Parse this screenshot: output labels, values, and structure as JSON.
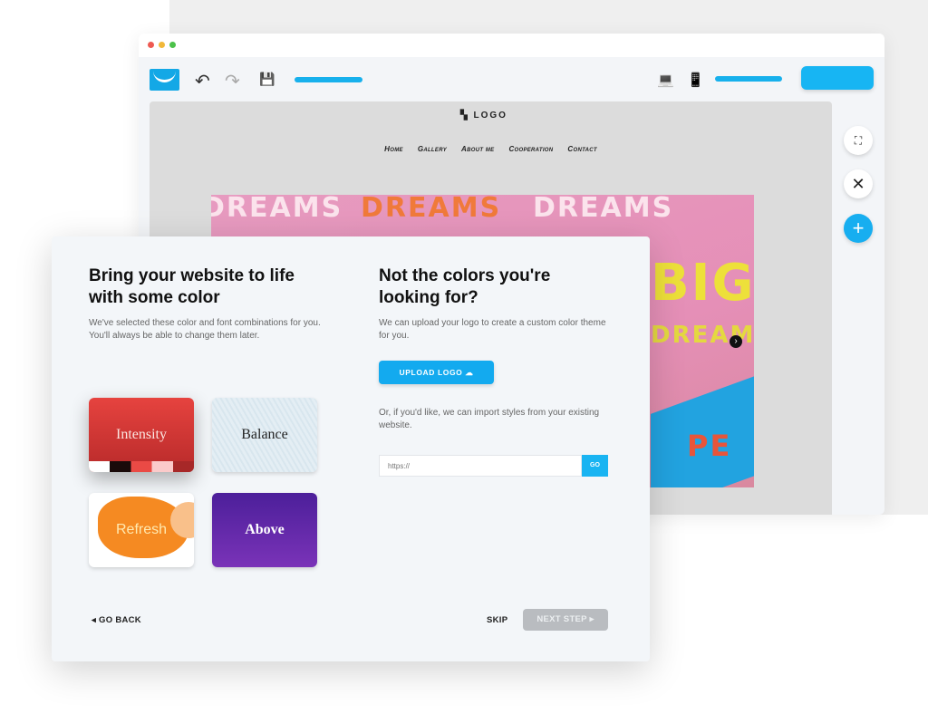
{
  "editor": {
    "site_logo": "LOGO",
    "nav": [
      "Home",
      "Gallery",
      "About me",
      "Cooperation",
      "Contact"
    ],
    "hero_texts": [
      "DREAMS",
      "DREAMS",
      "DREAMS",
      "BIG",
      "DREAMS",
      "PE"
    ],
    "icons": {
      "undo": "↶",
      "redo": "↷",
      "save": "💾",
      "laptop": "💻",
      "phone": "📱",
      "sitemap": "⛶",
      "close": "✕",
      "add": "+",
      "next": "›"
    }
  },
  "modal": {
    "left": {
      "title": "Bring your website to life with some color",
      "description": "We've selected these color and font combinations for you. You'll always be able to change them later."
    },
    "themes": [
      {
        "label": "Intensity"
      },
      {
        "label": "Balance"
      },
      {
        "label": "Refresh"
      },
      {
        "label": "Above"
      }
    ],
    "right": {
      "title": "Not the colors you're looking for?",
      "description": "We can upload your logo to create a custom color theme for you.",
      "upload_label": "UPLOAD LOGO",
      "import_text": "Or, if you'd like, we can import styles from your existing website.",
      "url_placeholder": "https://",
      "go_label": "GO"
    },
    "footer": {
      "back_label": "◂ GO BACK",
      "skip_label": "SKIP",
      "next_label": "NEXT STEP ▸"
    }
  },
  "colors": {
    "accent": "#13aaef"
  }
}
